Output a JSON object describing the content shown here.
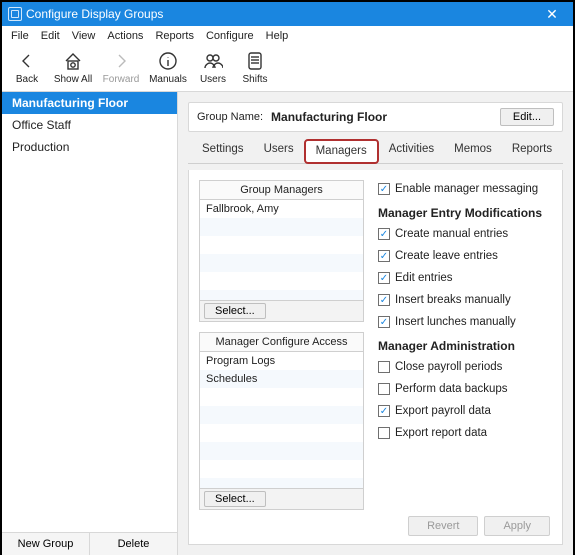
{
  "window": {
    "title": "Configure Display Groups"
  },
  "menubar": [
    "File",
    "Edit",
    "View",
    "Actions",
    "Reports",
    "Configure",
    "Help"
  ],
  "toolbar": {
    "back": "Back",
    "showAll": "Show All",
    "forward": "Forward",
    "manuals": "Manuals",
    "users": "Users",
    "shifts": "Shifts"
  },
  "sidebar": {
    "items": [
      {
        "label": "Manufacturing Floor",
        "selected": true
      },
      {
        "label": "Office Staff",
        "selected": false
      },
      {
        "label": "Production",
        "selected": false
      }
    ],
    "newGroup": "New Group",
    "delete": "Delete"
  },
  "header": {
    "label": "Group Name:",
    "value": "Manufacturing Floor",
    "edit": "Edit..."
  },
  "tabs": [
    {
      "label": "Settings",
      "active": false
    },
    {
      "label": "Users",
      "active": false
    },
    {
      "label": "Managers",
      "active": true
    },
    {
      "label": "Activities",
      "active": false
    },
    {
      "label": "Memos",
      "active": false
    },
    {
      "label": "Reports",
      "active": false
    }
  ],
  "leftPanel": {
    "managersTitle": "Group Managers",
    "managers": [
      "Fallbrook, Amy"
    ],
    "configTitle": "Manager Configure Access",
    "configItems": [
      "Program Logs",
      "Schedules"
    ],
    "selectLabel": "Select..."
  },
  "rightPanel": {
    "enableMsg": {
      "label": "Enable manager messaging",
      "checked": true
    },
    "section1": "Manager Entry Modifications",
    "modifications": [
      {
        "label": "Create manual entries",
        "checked": true
      },
      {
        "label": "Create leave entries",
        "checked": true
      },
      {
        "label": "Edit entries",
        "checked": true
      },
      {
        "label": "Insert breaks manually",
        "checked": true
      },
      {
        "label": "Insert lunches manually",
        "checked": true
      }
    ],
    "section2": "Manager Administration",
    "admin": [
      {
        "label": "Close payroll periods",
        "checked": false
      },
      {
        "label": "Perform data backups",
        "checked": false
      },
      {
        "label": "Export payroll data",
        "checked": true
      },
      {
        "label": "Export report data",
        "checked": false
      }
    ]
  },
  "footer": {
    "revert": "Revert",
    "apply": "Apply"
  }
}
